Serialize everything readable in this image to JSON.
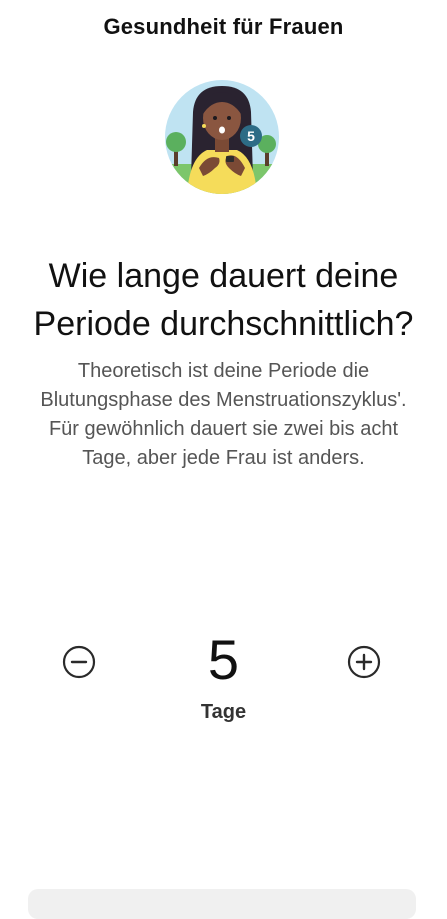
{
  "header": {
    "title": "Gesundheit für Frauen"
  },
  "illustration": {
    "badge_number": "5"
  },
  "question": {
    "line1": "Wie lange dauert deine",
    "line2": "Periode durchschnittlich?"
  },
  "description": {
    "line1": "Theoretisch ist deine Periode die",
    "line2": "Blutungsphase des Menstruationszyklus'.",
    "line3": "Für gewöhnlich dauert sie zwei bis acht",
    "line4": "Tage, aber jede Frau ist anders."
  },
  "stepper": {
    "value": "5",
    "unit": "Tage",
    "minus_icon": "minus-circle-icon",
    "plus_icon": "plus-circle-icon"
  },
  "colors": {
    "illustration_sky": "#bfe3f2",
    "illustration_shirt": "#f5dc5a",
    "badge": "#2d6c86"
  }
}
